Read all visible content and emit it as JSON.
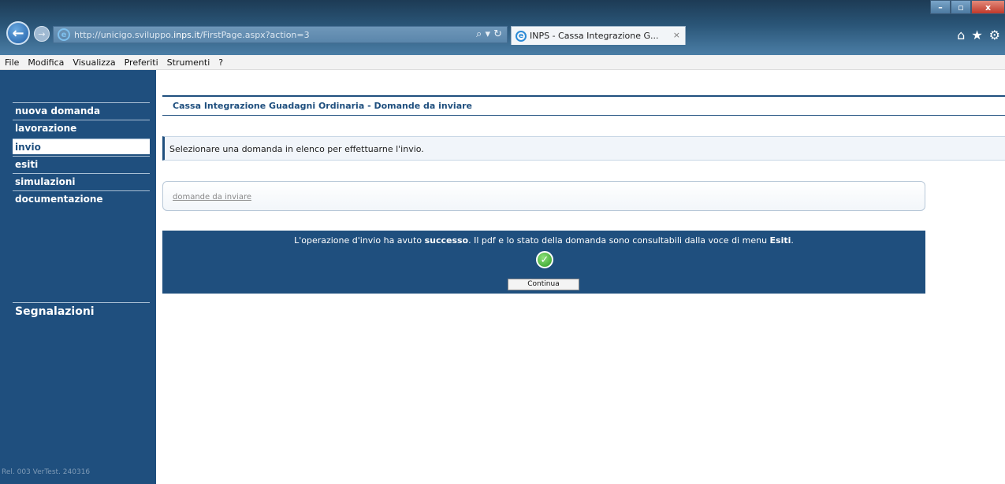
{
  "browser": {
    "url_prefix": "http://unicigo.sviluppo.",
    "url_domain": "inps.it",
    "url_suffix": "/FirstPage.aspx?action=3",
    "address_tools": "⌕ ▾ ↻",
    "tab_title": "INPS - Cassa Integrazione G...",
    "tab_close": "×",
    "window_controls": {
      "min": "–",
      "max": "▫",
      "close": "x"
    },
    "icons": [
      "home-icon",
      "favorites-star-icon",
      "settings-gear-icon"
    ]
  },
  "menubar": {
    "items": [
      "File",
      "Modifica",
      "Visualizza",
      "Preferiti",
      "Strumenti",
      "?"
    ]
  },
  "sidebar": {
    "items": [
      {
        "label": "nuova domanda",
        "active": false
      },
      {
        "label": "lavorazione",
        "active": false
      },
      {
        "label": "invio",
        "active": true
      },
      {
        "label": "esiti",
        "active": false
      },
      {
        "label": "simulazioni",
        "active": false
      },
      {
        "label": "documentazione",
        "active": false
      }
    ],
    "section_title": "Segnalazioni",
    "version": "Rel. 003 VerTest. 240316"
  },
  "main": {
    "heading": "Cassa Integrazione Guadagni Ordinaria - Domande da inviare",
    "info": "Selezionare una domanda in elenco per effettuarne l'invio.",
    "link": "domande da inviare",
    "success": {
      "msg_part1": "L'operazione d'invio ha avuto ",
      "msg_bold1": "successo",
      "msg_part2": ". Il pdf e lo stato della domanda sono consultabili dalla voce di menu ",
      "msg_bold2": "Esiti",
      "msg_part3": ".",
      "button": "Continua"
    }
  },
  "colors": {
    "sidebar_bg": "#1f4f7e",
    "accent": "#1f4f7e",
    "success_icon": "#2c9a22"
  }
}
